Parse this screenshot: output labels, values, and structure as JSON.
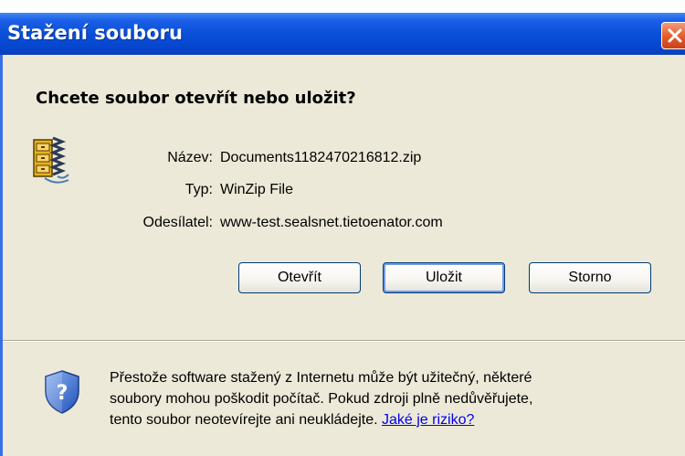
{
  "dialog": {
    "title": "Stažení souboru",
    "question": "Chcete soubor otevřít nebo uložit?"
  },
  "file": {
    "name_label": "Název:",
    "name_value": "Documents1182470216812.zip",
    "type_label": "Typ:",
    "type_value": "WinZip File",
    "from_label": "Odesílatel:",
    "from_value": "www-test.sealsnet.tietoenator.com",
    "icon": "winzip-archive-icon"
  },
  "buttons": {
    "open": "Otevřít",
    "save": "Uložit",
    "cancel": "Storno"
  },
  "warning": {
    "line1": "Přestože software stažený z Internetu může být užitečný, některé",
    "line2": "soubory mohou poškodit počítač. Pokud zdroji plně nedůvěřujete,",
    "line3": "tento soubor neotevírejte ani neukládejte. ",
    "link": "Jaké je riziko?",
    "icon": "shield-question-icon"
  },
  "colors": {
    "titlebar": "#0a4fd8",
    "close_button": "#e35a28",
    "client_background": "#ece9d8",
    "link": "#0000ee"
  }
}
